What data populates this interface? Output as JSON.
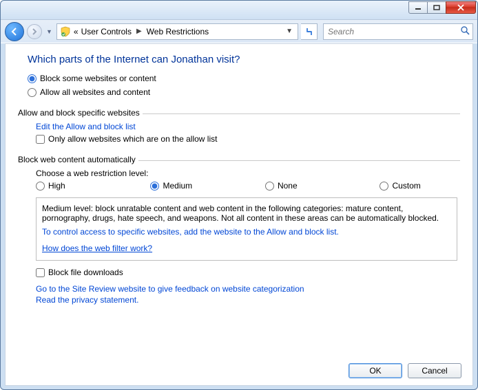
{
  "titlebar": {},
  "nav": {
    "breadcrumbs": {
      "prefix": "«",
      "item1": "User Controls",
      "item2": "Web Restrictions"
    },
    "search_placeholder": "Search"
  },
  "heading": "Which parts of the Internet can Jonathan visit?",
  "main_radios": {
    "block_some": "Block some websites or content",
    "allow_all": "Allow all websites and content",
    "selected": "block_some"
  },
  "section_allow_block": {
    "title": "Allow and block specific websites",
    "edit_link": "Edit the Allow and block list",
    "only_allowlist": "Only allow websites which are on the allow list",
    "only_allowlist_checked": false
  },
  "section_auto": {
    "title": "Block web content automatically",
    "choose_label": "Choose a web restriction level:",
    "levels": {
      "high": "High",
      "medium": "Medium",
      "none": "None",
      "custom": "Custom"
    },
    "selected_level": "medium",
    "description": "Medium level:  block unratable content and web content in the following categories:  mature content, pornography, drugs, hate speech, and weapons.  Not all content in these areas can be automatically blocked.",
    "control_link": "To control access to specific websites, add the website to the Allow and block list.",
    "how_link": "How does the web filter work?"
  },
  "block_downloads": {
    "label": "Block file downloads",
    "checked": false
  },
  "bottom_links": {
    "site_review": "Go to the Site Review website to give feedback on website categorization",
    "privacy": "Read the privacy statement."
  },
  "buttons": {
    "ok": "OK",
    "cancel": "Cancel"
  }
}
